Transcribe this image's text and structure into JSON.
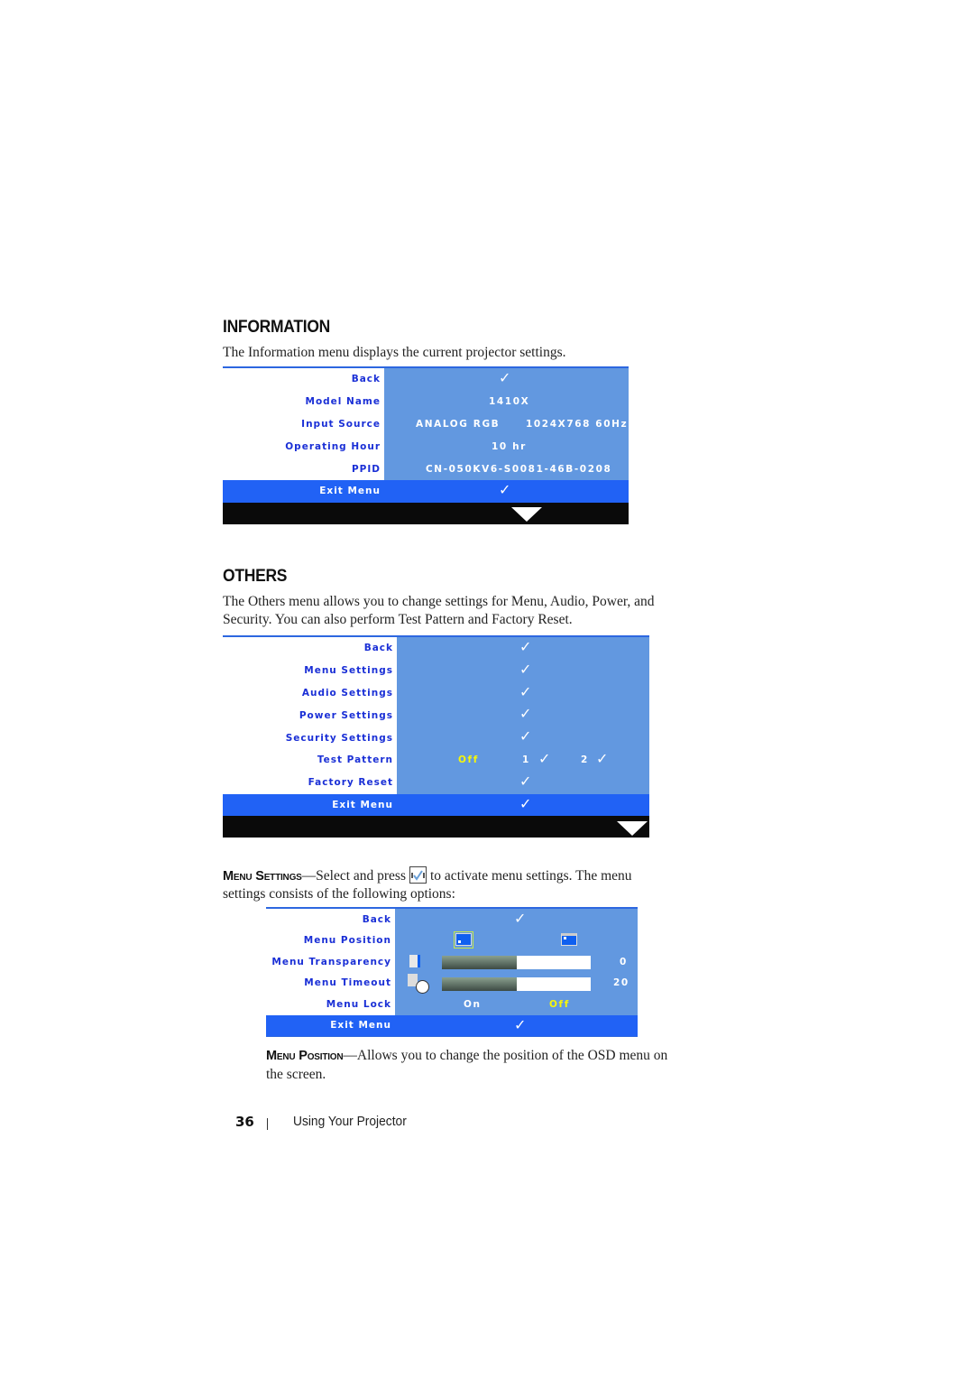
{
  "information": {
    "heading": "INFORMATION",
    "description": "The Information menu displays the current projector settings.",
    "menu": {
      "rows": [
        {
          "label": "Back",
          "value": "✓"
        },
        {
          "label": "Model Name",
          "value": "1410X"
        },
        {
          "label": "Input Source",
          "value": "ANALOG RGB",
          "value2": "1024X768 60Hz"
        },
        {
          "label": "Operating Hour",
          "value": "10 hr"
        },
        {
          "label": "PPID",
          "value": "CN-050KV6-S0081-46B-0208"
        }
      ],
      "exit": {
        "label": "Exit Menu",
        "value": "✓"
      },
      "scroll_icon": "triangle-down-icon"
    }
  },
  "others": {
    "heading": "OTHERS",
    "description_line1": "The Others menu allows you to change settings for Menu, Audio, Power, and",
    "description_line2": "Security. You can also perform Test Pattern and Factory Reset.",
    "menu": {
      "rows": [
        {
          "label": "Back",
          "value": "✓"
        },
        {
          "label": "Menu Settings",
          "value": "✓"
        },
        {
          "label": "Audio Settings",
          "value": "✓"
        },
        {
          "label": "Power Settings",
          "value": "✓"
        },
        {
          "label": "Security Settings",
          "value": "✓"
        },
        {
          "label": "Test Pattern",
          "options": [
            "Off",
            "1",
            "2"
          ],
          "selected": "Off",
          "check": "✓"
        },
        {
          "label": "Factory Reset",
          "value": "✓"
        }
      ],
      "exit": {
        "label": "Exit Menu",
        "value": "✓"
      },
      "scroll_icon": "triangle-down-icon"
    }
  },
  "menu_settings": {
    "lead": "Menu Settings",
    "dash": "—",
    "text_before_icon": "Select and press",
    "icon": "enter-check-icon",
    "text_after_icon": "to activate menu settings. The menu",
    "text_line2": "settings consists of the following options:",
    "menu": {
      "back": {
        "label": "Back",
        "value": "✓"
      },
      "position": {
        "label": "Menu Position",
        "options": [
          "bottom-left",
          "top-left"
        ],
        "selected": "bottom-left"
      },
      "transparency": {
        "label": "Menu Transparency",
        "value": "0",
        "level": 0.5
      },
      "timeout": {
        "label": "Menu Timeout",
        "value": "20",
        "level": 0.5
      },
      "lock": {
        "label": "Menu Lock",
        "options": [
          "On",
          "Off"
        ],
        "selected": "Off"
      },
      "exit": {
        "label": "Exit Menu",
        "value": "✓"
      }
    }
  },
  "menu_position": {
    "lead": "Menu Position",
    "dash": "—",
    "text": "Allows you to change the position of the OSD menu on",
    "text_line2": "the screen."
  },
  "footer": {
    "page_number": "36",
    "separator": "|",
    "section_title": "Using Your Projector"
  }
}
